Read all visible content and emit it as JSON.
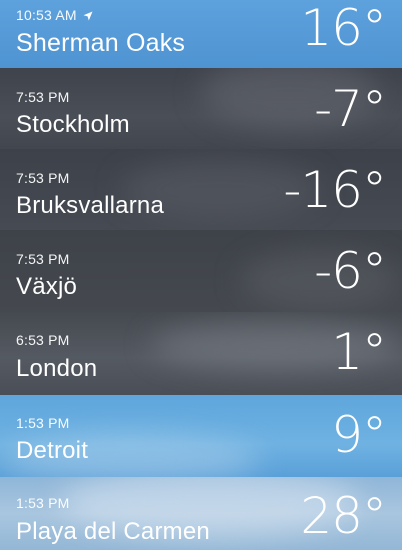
{
  "rows": [
    {
      "time": "10:53 AM",
      "city": "Sherman Oaks",
      "temp": "16°",
      "current_location": true,
      "theme": "clear-day"
    },
    {
      "time": "7:53 PM",
      "city": "Stockholm",
      "temp": "-7°",
      "theme": "night-cloudy"
    },
    {
      "time": "7:53 PM",
      "city": "Bruksvallarna",
      "temp": "-16°",
      "theme": "night-cloudy"
    },
    {
      "time": "7:53 PM",
      "city": "Växjö",
      "temp": "-6°",
      "theme": "night-cloudy"
    },
    {
      "time": "6:53 PM",
      "city": "London",
      "temp": "1°",
      "theme": "night-cloudy"
    },
    {
      "time": "1:53 PM",
      "city": "Detroit",
      "temp": "9°",
      "theme": "day-clear"
    },
    {
      "time": "1:53 PM",
      "city": "Playa del Carmen",
      "temp": "28°",
      "theme": "day-cloudy"
    }
  ],
  "icons": {
    "current_location": "location-arrow-icon"
  }
}
